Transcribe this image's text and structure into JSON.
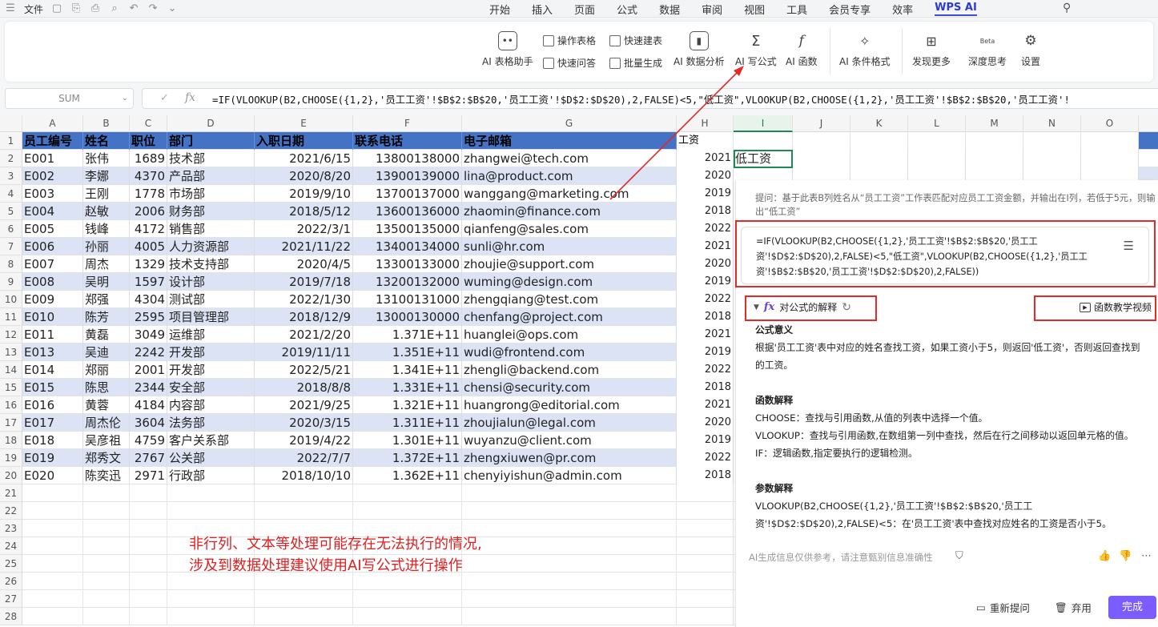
{
  "menubar": {
    "file_label": "文件",
    "tabs": [
      "开始",
      "插入",
      "页面",
      "公式",
      "数据",
      "审阅",
      "视图",
      "工具",
      "会员专享",
      "效率"
    ],
    "wps_ai_label": "WPS AI"
  },
  "ribbon": {
    "table_assistant": "AI 表格助手",
    "operate_table": "操作表格",
    "quick_build": "快速建表",
    "quick_qa": "快速问答",
    "batch_generate": "批量生成",
    "data_analysis": "AI 数据分析",
    "write_formula": "AI 写公式",
    "function": "AI 函数",
    "conditional_format": "AI 条件格式",
    "discover_more": "发现更多",
    "deep_think": "深度思考",
    "deep_think_badge": "Beta",
    "settings": "设置"
  },
  "formula_bar": {
    "name_box": "SUM",
    "formula": "=IF(VLOOKUP(B2,CHOOSE({1,2},'员工工资'!$B$2:$B$20,'员工工资'!$D$2:$D$20),2,FALSE)<5,\"低工资\",VLOOKUP(B2,CHOOSE({1,2},'员工工资'!$B$2:$B$20,'员工工资'!"
  },
  "sheet": {
    "columns": [
      "A",
      "B",
      "C",
      "D",
      "E",
      "F",
      "G",
      "H",
      "I",
      "J",
      "K",
      "L",
      "M",
      "N",
      "O"
    ],
    "headers": [
      "员工编号",
      "姓名",
      "职位",
      "部门",
      "入职日期",
      "联系电话",
      "电子邮箱",
      "工资",
      ""
    ],
    "rows": [
      [
        "E001",
        "张伟",
        "1689",
        "技术部",
        "2021/6/15",
        "13800138000",
        "zhangwei@tech.com",
        "2021",
        "低工资"
      ],
      [
        "E002",
        "李娜",
        "4370",
        "产品部",
        "2020/8/20",
        "13900139000",
        "lina@product.com",
        "2020",
        ""
      ],
      [
        "E003",
        "王刚",
        "1778",
        "市场部",
        "2019/9/10",
        "13700137000",
        "wanggang@marketing.com",
        "2019",
        ""
      ],
      [
        "E004",
        "赵敏",
        "2006",
        "财务部",
        "2018/5/12",
        "13600136000",
        "zhaomin@finance.com",
        "2018",
        ""
      ],
      [
        "E005",
        "钱峰",
        "4172",
        "销售部",
        "2022/3/1",
        "13500135000",
        "qianfeng@sales.com",
        "2022",
        ""
      ],
      [
        "E006",
        "孙丽",
        "4005",
        "人力资源部",
        "2021/11/22",
        "13400134000",
        "sunli@hr.com",
        "2021",
        ""
      ],
      [
        "E007",
        "周杰",
        "1329",
        "技术支持部",
        "2020/4/5",
        "13300133000",
        "zhoujie@support.com",
        "2020",
        ""
      ],
      [
        "E008",
        "吴明",
        "1597",
        "设计部",
        "2019/7/18",
        "13200132000",
        "wuming@design.com",
        "2019",
        ""
      ],
      [
        "E009",
        "郑强",
        "4304",
        "测试部",
        "2022/1/30",
        "13100131000",
        "zhengqiang@test.com",
        "2022",
        ""
      ],
      [
        "E010",
        "陈芳",
        "2595",
        "项目管理部",
        "2018/12/9",
        "13000130000",
        "chenfang@project.com",
        "2018",
        ""
      ],
      [
        "E011",
        "黄磊",
        "3049",
        "运维部",
        "2021/2/20",
        "1.371E+11",
        "huanglei@ops.com",
        "2021",
        ""
      ],
      [
        "E013",
        "吴迪",
        "2242",
        "开发部",
        "2019/11/11",
        "1.351E+11",
        "wudi@frontend.com",
        "2019",
        ""
      ],
      [
        "E014",
        "郑丽",
        "2001",
        "开发部",
        "2022/5/21",
        "1.341E+11",
        "zhengli@backend.com",
        "2022",
        ""
      ],
      [
        "E015",
        "陈思",
        "2344",
        "安全部",
        "2018/8/8",
        "1.331E+11",
        "chensi@security.com",
        "2018",
        ""
      ],
      [
        "E016",
        "黄蓉",
        "4184",
        "内容部",
        "2021/9/25",
        "1.321E+11",
        "huangrong@editorial.com",
        "2021",
        ""
      ],
      [
        "E017",
        "周杰伦",
        "3604",
        "法务部",
        "2020/3/15",
        "1.311E+11",
        "zhoujialun@legal.com",
        "2020",
        ""
      ],
      [
        "E018",
        "吴彦祖",
        "4759",
        "客户关系部",
        "2019/4/22",
        "1.301E+11",
        "wuyanzu@client.com",
        "2019",
        ""
      ],
      [
        "E019",
        "郑秀文",
        "2767",
        "公关部",
        "2022/7/7",
        "1.372E+11",
        "zhengxiuwen@pr.com",
        "2022",
        ""
      ],
      [
        "E020",
        "陈奕迅",
        "2971",
        "行政部",
        "2018/10/10",
        "1.362E+11",
        "chenyiyishun@admin.com",
        "2018",
        ""
      ]
    ],
    "empty_row_numbers": [
      "21",
      "22",
      "23",
      "24",
      "25",
      "26",
      "27",
      "28"
    ]
  },
  "annotation": {
    "line1": "非行列、文本等处理可能存在无法执行的情况,",
    "line2": "涉及到数据处理建议使用AI写公式进行操作"
  },
  "ai_panel": {
    "prompt": "提问：基于此表B列姓名从“员工工资”工作表匹配对应员工工资金额，并输出在I列，若低于5元，则输出“低工资”",
    "formula_result": "=IF(VLOOKUP(B2,CHOOSE({1,2},'员工工资'!$B$2:$B$20,'员工工资'!$D$2:$D$20),2,FALSE)<5,\"低工资\",VLOOKUP(B2,CHOOSE({1,2},'员工工资'!$B$2:$B$20,'员工工资'!$D$2:$D$20),2,FALSE))",
    "explain_label": "对公式的解释",
    "video_label": "函数教学视频",
    "meaning_title": "公式意义",
    "meaning_text": "根据'员工工资'表中对应的姓名查找工资，如果工资小于5，则返回'低工资'，否则返回查找到的工资。",
    "func_title": "函数解释",
    "func_choose": "CHOOSE：查找与引用函数,从值的列表中选择一个值。",
    "func_vlookup": "VLOOKUP：查找与引用函数,在数组第一列中查找，然后在行之间移动以返回单元格的值。",
    "func_if": "IF：逻辑函数,指定要执行的逻辑检测。",
    "param_title": "参数解释",
    "param_text": "VLOOKUP(B2,CHOOSE({1,2},'员工工资'!$B$2:$B$20,'员工工资'!$D$2:$D$20),2,FALSE)<5：在'员工工资'表中查找对应姓名的工资是否小于5。",
    "disclaimer": "AI生成信息仅供参考，请注意甄别信息准确性",
    "reask": "重新提问",
    "discard": "弃用",
    "done": "完成"
  },
  "colors": {
    "header_blue": "#4472c4",
    "band_blue": "#dbe3f4",
    "accent_purple": "#7b5cff",
    "annotation_red": "#e02020"
  }
}
